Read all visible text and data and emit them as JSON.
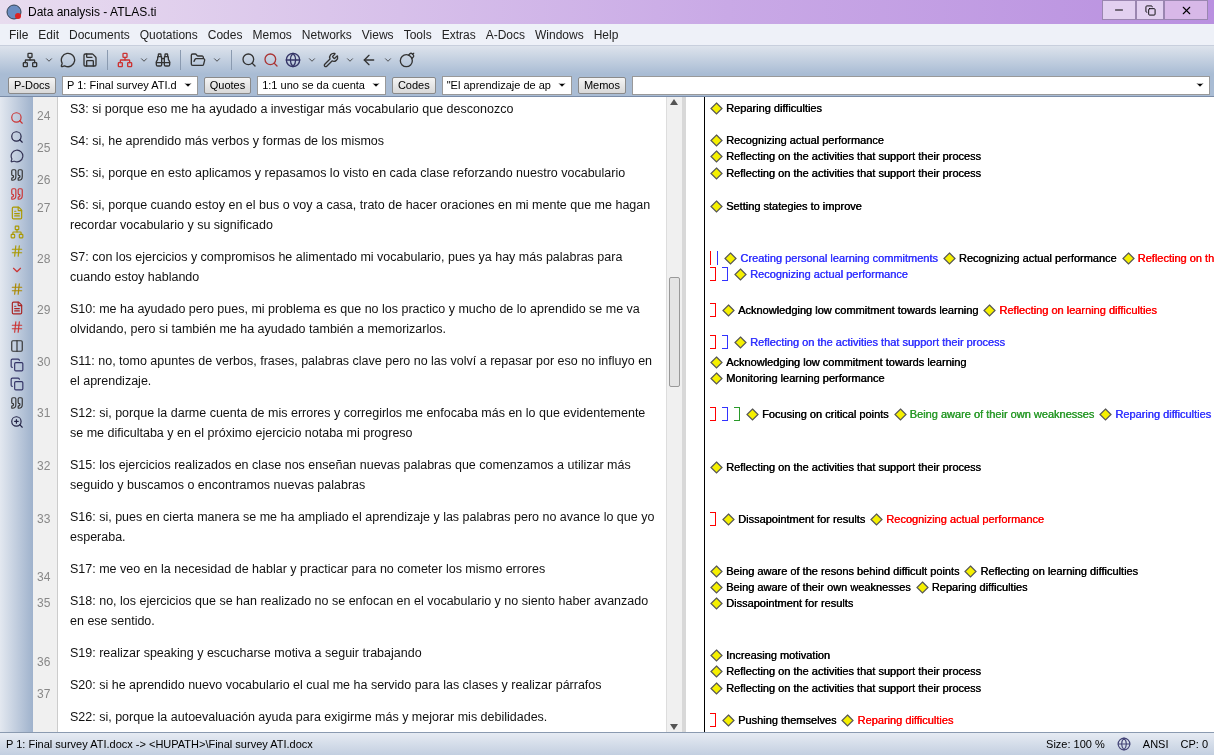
{
  "window": {
    "title": "Data analysis - ATLAS.ti"
  },
  "menu": [
    "File",
    "Edit",
    "Documents",
    "Quotations",
    "Codes",
    "Memos",
    "Networks",
    "Views",
    "Tools",
    "Extras",
    "A-Docs",
    "Windows",
    "Help"
  ],
  "selectors": [
    {
      "button": "P-Docs",
      "value": "P 1: Final survey ATI.d"
    },
    {
      "button": "Quotes",
      "value": "1:1 uno se da cuenta"
    },
    {
      "button": "Codes",
      "value": "\"El aprendizaje de ap"
    },
    {
      "button": "Memos"
    }
  ],
  "line_numbers": [
    "24",
    "25",
    "26",
    "27",
    "28",
    "29",
    "30",
    "31",
    "32",
    "33",
    "34",
    "35",
    "36",
    "37"
  ],
  "paragraphs": [
    "S3: si porque eso me ha ayudado a investigar más vocabulario que desconozco",
    "S4: si, he aprendido más verbos y formas de los mismos",
    "S5: si, porque en esto aplicamos y repasamos lo visto en cada clase reforzando nuestro vocabulario",
    "S6: si, porque cuando estoy en el bus o voy a casa, trato de hacer oraciones en mi mente que me hagan recordar vocabulario y su significado",
    "S7: con los ejercicios y compromisos he alimentado mi vocabulario, pues ya hay más palabras para cuando estoy hablando",
    "S10: me ha ayudado pero pues, mi problema es que no los practico y mucho de lo aprendido se me va olvidando, pero si también me ha ayudado también a memorizarlos.",
    "S11: no, tomo apuntes de verbos, frases, palabras clave pero no las volví a repasar por eso no influyo en el aprendizaje.",
    "S12: si, porque la darme cuenta de mis errores y corregirlos me enfocaba más en lo que evidentemente se me dificultaba y en el próximo ejercicio notaba mi progreso",
    "S15: los ejercicios realizados en clase nos enseñan nuevas palabras que comenzamos a utilizar más seguido y buscamos o encontramos nuevas palabras",
    "S16: si, pues en cierta manera se me ha ampliado el aprendizaje y las palabras pero no avance lo que yo esperaba.",
    "S17: me veo en la necesidad de hablar y practicar para no cometer los mismo errores",
    "S18: no, los ejercicios que se han realizado no se enfocan en el vocabulario y no siento haber avanzado en ese sentido.",
    "S19: realizar speaking y escucharse motiva a seguir trabajando",
    "S20: si he aprendido nuevo vocabulario el cual me ha servido para las clases y realizar párrafos",
    "S22: si, porque la autoevaluación ayuda para exigirme más y mejorar mis debilidades."
  ],
  "margin": [
    {
      "codes": [
        {
          "label": "Reparing difficulties",
          "color": "#000000"
        }
      ]
    },
    {
      "codes": [
        {
          "label": "Recognizing  actual performance",
          "color": "#000000"
        }
      ]
    },
    {
      "codes": [
        {
          "label": "Reflecting on the activities that support their process",
          "color": "#000000"
        }
      ]
    },
    {
      "codes": [
        {
          "label": "Reflecting on the activities that support their process",
          "color": "#000000"
        }
      ]
    },
    {
      "codes": [
        {
          "label": "Setting stategies to improve",
          "color": "#000000"
        }
      ]
    },
    {
      "brackets": [
        {
          "color": "#ff0000"
        },
        {
          "color": "#3333ff"
        }
      ],
      "codes": [
        {
          "label": "Creating personal learning commitments",
          "color": "#3333ff"
        },
        {
          "label": "Recognizing  actual performance",
          "color": "#000000"
        },
        {
          "label": "Reflecting on th",
          "color": "#ff0000"
        }
      ]
    },
    {
      "brackets": [
        {
          "color": "#ff0000"
        },
        {
          "color": "#3333ff"
        }
      ],
      "codes": [
        {
          "label": "Recognizing  actual performance",
          "color": "#3333ff"
        }
      ]
    },
    {
      "brackets": [
        {
          "color": "#ff0000"
        }
      ],
      "codes": [
        {
          "label": "Acknowledging low commitment towards learning",
          "color": "#000000"
        },
        {
          "label": "Reflecting on learning difficulties",
          "color": "#ff0000"
        }
      ]
    },
    {
      "brackets": [
        {
          "color": "#ff0000"
        },
        {
          "color": "#3333ff"
        }
      ],
      "codes": [
        {
          "label": "Reflecting on the activities that support their process",
          "color": "#3333ff"
        }
      ]
    },
    {
      "codes": [
        {
          "label": "Acknowledging low commitment towards learning",
          "color": "#000000"
        }
      ]
    },
    {
      "codes": [
        {
          "label": "Monitoring learning performance",
          "color": "#000000"
        }
      ]
    },
    {
      "brackets": [
        {
          "color": "#ff0000"
        },
        {
          "color": "#3333ff"
        },
        {
          "color": "#2a9a2a"
        }
      ],
      "codes": [
        {
          "label": "Focusing on critical points",
          "color": "#000000"
        },
        {
          "label": "Being aware of their own weaknesses",
          "color": "#2a9a2a"
        },
        {
          "label": "Reparing difficulties",
          "color": "#3333ff"
        }
      ]
    },
    {
      "codes": [
        {
          "label": "Reflecting on the activities that support their process",
          "color": "#000000"
        }
      ]
    },
    {
      "brackets": [
        {
          "color": "#ff0000"
        }
      ],
      "codes": [
        {
          "label": "Dissapointment for results",
          "color": "#000000"
        },
        {
          "label": "Recognizing  actual performance",
          "color": "#ff0000"
        }
      ]
    },
    {
      "codes": [
        {
          "label": "Being aware of the resons behind difficult points",
          "color": "#000000"
        },
        {
          "label": "Reflecting on learning difficulties",
          "color": "#000000"
        }
      ]
    },
    {
      "codes": [
        {
          "label": "Being aware of their own weaknesses",
          "color": "#000000"
        },
        {
          "label": "Reparing difficulties",
          "color": "#000000"
        }
      ]
    },
    {
      "codes": [
        {
          "label": "Dissapointment for results",
          "color": "#000000"
        }
      ]
    },
    {
      "codes": [
        {
          "label": "Increasing motivation",
          "color": "#000000"
        }
      ]
    },
    {
      "codes": [
        {
          "label": "Reflecting on the activities that support their process",
          "color": "#000000"
        }
      ]
    },
    {
      "codes": [
        {
          "label": "Reflecting on the activities that support their process",
          "color": "#000000"
        }
      ]
    },
    {
      "brackets": [
        {
          "color": "#ff0000"
        }
      ],
      "codes": [
        {
          "label": "Pushing themselves",
          "color": "#000000"
        },
        {
          "label": "Reparing difficulties",
          "color": "#ff0000"
        }
      ]
    }
  ],
  "status_bar": {
    "path": "P 1: Final survey ATI.docx -> <HUPATH>\\Final survey ATI.docx",
    "size": "Size: 100 %",
    "encoding": "ANSI",
    "cp": "CP: 0"
  }
}
